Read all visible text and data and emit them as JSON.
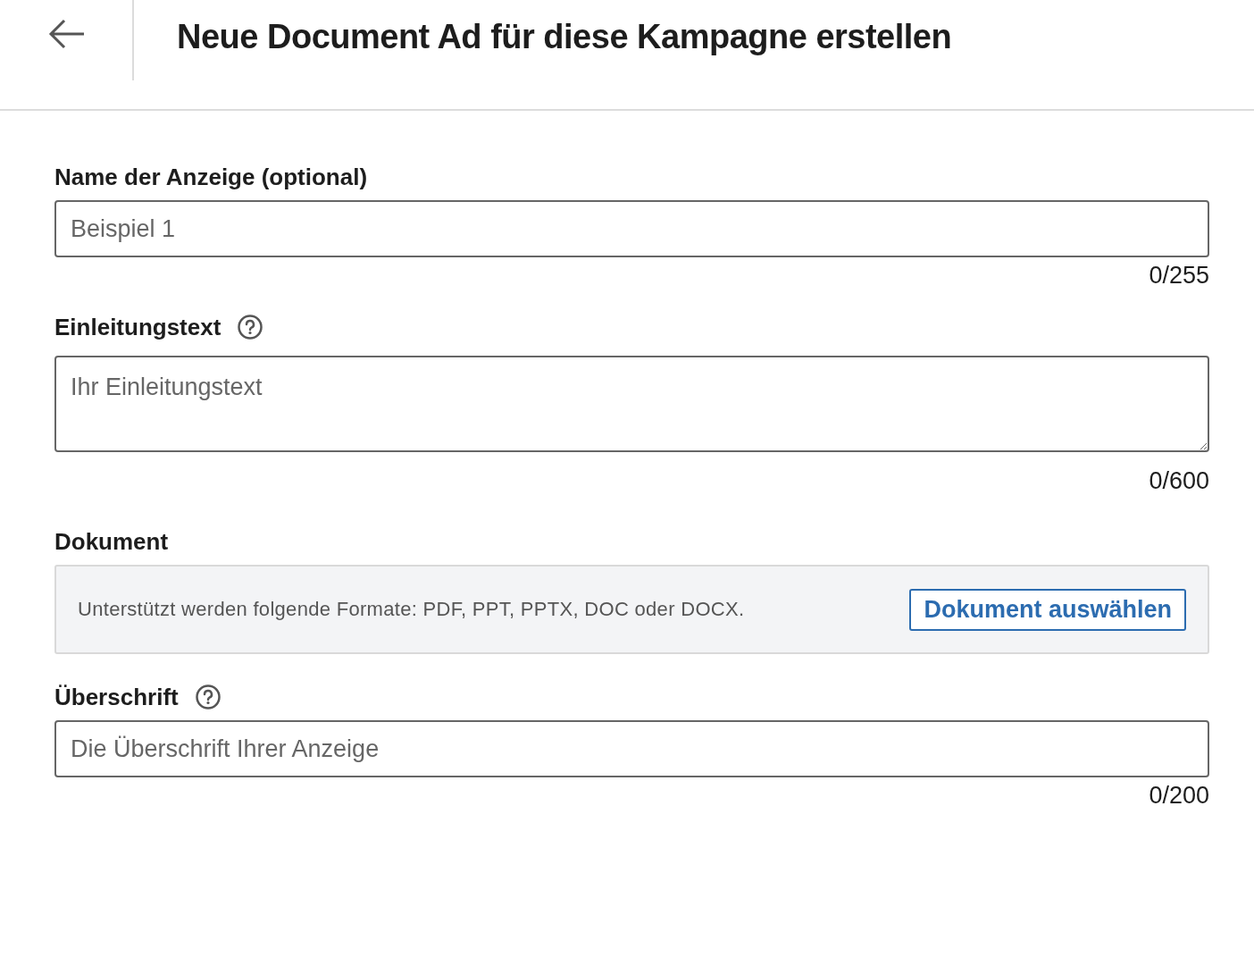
{
  "header": {
    "title": "Neue Document Ad für diese Kampagne erstellen"
  },
  "fields": [
    {
      "kind": "input",
      "label": "Name der Anzeige (optional)",
      "help": false,
      "placeholder": "Beispiel 1",
      "counter": "0/255"
    },
    {
      "kind": "textarea",
      "label": "Einleitungstext",
      "help": true,
      "placeholder": "Ihr Einleitungstext",
      "counter": "0/600"
    },
    {
      "kind": "upload",
      "label": "Dokument",
      "help": false,
      "hint": "Unterstützt werden folgende Formate: PDF, PPT, PPTX, DOC oder DOCX.",
      "button": "Dokument auswählen"
    },
    {
      "kind": "input",
      "label": "Überschrift",
      "help": true,
      "placeholder": "Die Überschrift Ihrer Anzeige",
      "counter": "0/200"
    }
  ]
}
